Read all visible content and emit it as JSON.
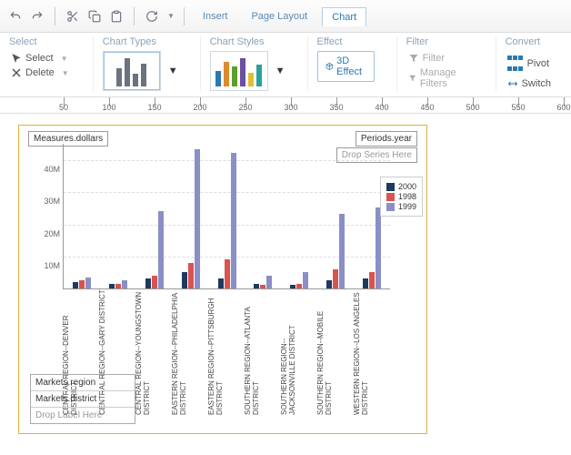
{
  "tabs": {
    "insert": "Insert",
    "page_layout": "Page Layout",
    "chart": "Chart"
  },
  "ribbon": {
    "select_group": "Select",
    "select": "Select",
    "delete": "Delete",
    "chart_types": "Chart Types",
    "chart_styles": "Chart Styles",
    "effect": "Effect",
    "effect_btn": "3D Effect",
    "filter_group": "Filter",
    "filter": "Filter",
    "manage_filters": "Manage Filters",
    "convert": "Convert",
    "pivot": "Pivot",
    "switch": "Switch"
  },
  "ruler_ticks": [
    50,
    100,
    150,
    200,
    250,
    300,
    350,
    400,
    450,
    500,
    550,
    600
  ],
  "fields": {
    "measures": "Measures.dollars",
    "periods": "Periods.year",
    "drop_series": "Drop Series Here",
    "region": "Markets.region",
    "district": "Markets.district",
    "drop_label": "Drop Label Here"
  },
  "legend": {
    "a": "2000",
    "b": "1998",
    "c": "1999"
  },
  "chart_data": {
    "type": "bar",
    "ylabel": "",
    "ylim": [
      0,
      45000000
    ],
    "yticks": [
      "10M",
      "20M",
      "30M",
      "40M"
    ],
    "categories": [
      "CENTRAL REGION--DENVER DISTRICT",
      "CENTRAL REGION--GARY DISTRICT",
      "CENTRAL REGION--YOUNGSTOWN DISTRICT",
      "EASTERN REGION--PHILADELPHIA DISTRICT",
      "EASTERN REGION--PITTSBURGH DISTRICT",
      "SOUTHERN REGION--ATLANTA DISTRICT",
      "SOUTHERN REGION--JACKSONVILLE DISTRICT",
      "SOUTHERN REGION--MOBILE DISTRICT",
      "WESTERN REGION--LOS ANGELES DISTRICT"
    ],
    "series": [
      {
        "name": "2000",
        "values": [
          2000000,
          1500000,
          3000000,
          5000000,
          3000000,
          1500000,
          1000000,
          2500000,
          3000000
        ]
      },
      {
        "name": "1998",
        "values": [
          2500000,
          1500000,
          4000000,
          8000000,
          9000000,
          1000000,
          1500000,
          6000000,
          5000000
        ]
      },
      {
        "name": "1999",
        "values": [
          3500000,
          2500000,
          24000000,
          43000000,
          42000000,
          4000000,
          5000000,
          23000000,
          25000000
        ]
      }
    ]
  }
}
